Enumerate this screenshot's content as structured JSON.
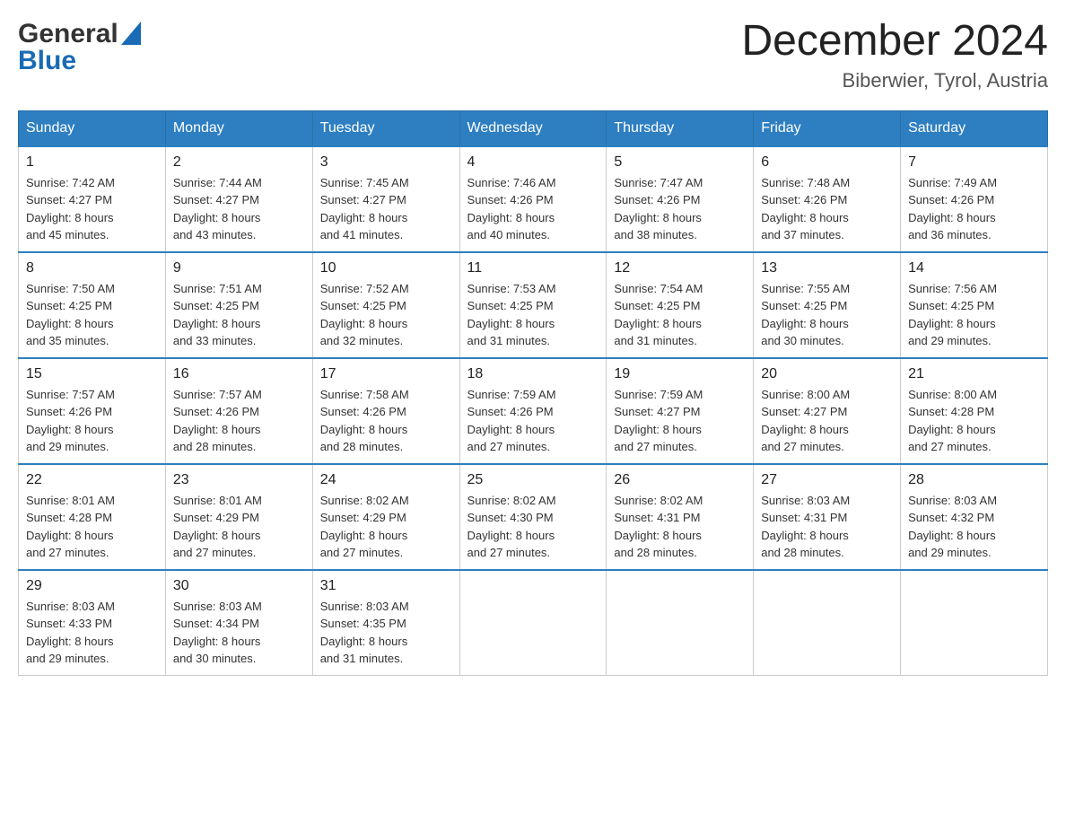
{
  "header": {
    "logo_general": "General",
    "logo_blue": "Blue",
    "month_title": "December 2024",
    "location": "Biberwier, Tyrol, Austria"
  },
  "days_of_week": [
    "Sunday",
    "Monday",
    "Tuesday",
    "Wednesday",
    "Thursday",
    "Friday",
    "Saturday"
  ],
  "weeks": [
    [
      {
        "day": "1",
        "sunrise": "7:42 AM",
        "sunset": "4:27 PM",
        "daylight": "8 hours and 45 minutes."
      },
      {
        "day": "2",
        "sunrise": "7:44 AM",
        "sunset": "4:27 PM",
        "daylight": "8 hours and 43 minutes."
      },
      {
        "day": "3",
        "sunrise": "7:45 AM",
        "sunset": "4:27 PM",
        "daylight": "8 hours and 41 minutes."
      },
      {
        "day": "4",
        "sunrise": "7:46 AM",
        "sunset": "4:26 PM",
        "daylight": "8 hours and 40 minutes."
      },
      {
        "day": "5",
        "sunrise": "7:47 AM",
        "sunset": "4:26 PM",
        "daylight": "8 hours and 38 minutes."
      },
      {
        "day": "6",
        "sunrise": "7:48 AM",
        "sunset": "4:26 PM",
        "daylight": "8 hours and 37 minutes."
      },
      {
        "day": "7",
        "sunrise": "7:49 AM",
        "sunset": "4:26 PM",
        "daylight": "8 hours and 36 minutes."
      }
    ],
    [
      {
        "day": "8",
        "sunrise": "7:50 AM",
        "sunset": "4:25 PM",
        "daylight": "8 hours and 35 minutes."
      },
      {
        "day": "9",
        "sunrise": "7:51 AM",
        "sunset": "4:25 PM",
        "daylight": "8 hours and 33 minutes."
      },
      {
        "day": "10",
        "sunrise": "7:52 AM",
        "sunset": "4:25 PM",
        "daylight": "8 hours and 32 minutes."
      },
      {
        "day": "11",
        "sunrise": "7:53 AM",
        "sunset": "4:25 PM",
        "daylight": "8 hours and 31 minutes."
      },
      {
        "day": "12",
        "sunrise": "7:54 AM",
        "sunset": "4:25 PM",
        "daylight": "8 hours and 31 minutes."
      },
      {
        "day": "13",
        "sunrise": "7:55 AM",
        "sunset": "4:25 PM",
        "daylight": "8 hours and 30 minutes."
      },
      {
        "day": "14",
        "sunrise": "7:56 AM",
        "sunset": "4:25 PM",
        "daylight": "8 hours and 29 minutes."
      }
    ],
    [
      {
        "day": "15",
        "sunrise": "7:57 AM",
        "sunset": "4:26 PM",
        "daylight": "8 hours and 29 minutes."
      },
      {
        "day": "16",
        "sunrise": "7:57 AM",
        "sunset": "4:26 PM",
        "daylight": "8 hours and 28 minutes."
      },
      {
        "day": "17",
        "sunrise": "7:58 AM",
        "sunset": "4:26 PM",
        "daylight": "8 hours and 28 minutes."
      },
      {
        "day": "18",
        "sunrise": "7:59 AM",
        "sunset": "4:26 PM",
        "daylight": "8 hours and 27 minutes."
      },
      {
        "day": "19",
        "sunrise": "7:59 AM",
        "sunset": "4:27 PM",
        "daylight": "8 hours and 27 minutes."
      },
      {
        "day": "20",
        "sunrise": "8:00 AM",
        "sunset": "4:27 PM",
        "daylight": "8 hours and 27 minutes."
      },
      {
        "day": "21",
        "sunrise": "8:00 AM",
        "sunset": "4:28 PM",
        "daylight": "8 hours and 27 minutes."
      }
    ],
    [
      {
        "day": "22",
        "sunrise": "8:01 AM",
        "sunset": "4:28 PM",
        "daylight": "8 hours and 27 minutes."
      },
      {
        "day": "23",
        "sunrise": "8:01 AM",
        "sunset": "4:29 PM",
        "daylight": "8 hours and 27 minutes."
      },
      {
        "day": "24",
        "sunrise": "8:02 AM",
        "sunset": "4:29 PM",
        "daylight": "8 hours and 27 minutes."
      },
      {
        "day": "25",
        "sunrise": "8:02 AM",
        "sunset": "4:30 PM",
        "daylight": "8 hours and 27 minutes."
      },
      {
        "day": "26",
        "sunrise": "8:02 AM",
        "sunset": "4:31 PM",
        "daylight": "8 hours and 28 minutes."
      },
      {
        "day": "27",
        "sunrise": "8:03 AM",
        "sunset": "4:31 PM",
        "daylight": "8 hours and 28 minutes."
      },
      {
        "day": "28",
        "sunrise": "8:03 AM",
        "sunset": "4:32 PM",
        "daylight": "8 hours and 29 minutes."
      }
    ],
    [
      {
        "day": "29",
        "sunrise": "8:03 AM",
        "sunset": "4:33 PM",
        "daylight": "8 hours and 29 minutes."
      },
      {
        "day": "30",
        "sunrise": "8:03 AM",
        "sunset": "4:34 PM",
        "daylight": "8 hours and 30 minutes."
      },
      {
        "day": "31",
        "sunrise": "8:03 AM",
        "sunset": "4:35 PM",
        "daylight": "8 hours and 31 minutes."
      },
      null,
      null,
      null,
      null
    ]
  ],
  "labels": {
    "sunrise": "Sunrise:",
    "sunset": "Sunset:",
    "daylight": "Daylight:"
  }
}
